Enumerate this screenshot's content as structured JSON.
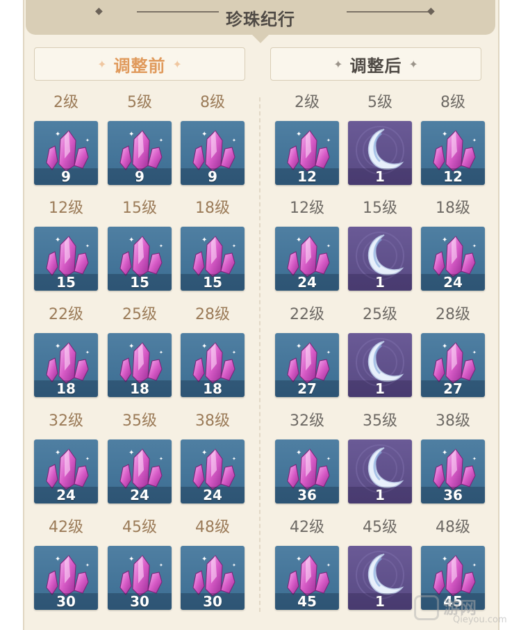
{
  "banner": {
    "title": "珍珠纪行"
  },
  "before": {
    "label": "调整前"
  },
  "after": {
    "label": "调整后"
  },
  "star_glyph": "✦",
  "levels": [
    [
      "2级",
      "5级",
      "8级"
    ],
    [
      "12级",
      "15级",
      "18级"
    ],
    [
      "22级",
      "25级",
      "28级"
    ],
    [
      "32级",
      "35级",
      "38级"
    ],
    [
      "42级",
      "45级",
      "48级"
    ]
  ],
  "before_rewards": [
    [
      {
        "item": "crystal",
        "count": "9"
      },
      {
        "item": "crystal",
        "count": "9"
      },
      {
        "item": "crystal",
        "count": "9"
      }
    ],
    [
      {
        "item": "crystal",
        "count": "15"
      },
      {
        "item": "crystal",
        "count": "15"
      },
      {
        "item": "crystal",
        "count": "15"
      }
    ],
    [
      {
        "item": "crystal",
        "count": "18"
      },
      {
        "item": "crystal",
        "count": "18"
      },
      {
        "item": "crystal",
        "count": "18"
      }
    ],
    [
      {
        "item": "crystal",
        "count": "24"
      },
      {
        "item": "crystal",
        "count": "24"
      },
      {
        "item": "crystal",
        "count": "24"
      }
    ],
    [
      {
        "item": "crystal",
        "count": "30"
      },
      {
        "item": "crystal",
        "count": "30"
      },
      {
        "item": "crystal",
        "count": "30"
      }
    ]
  ],
  "after_rewards": [
    [
      {
        "item": "crystal",
        "count": "12"
      },
      {
        "item": "moon",
        "count": "1"
      },
      {
        "item": "crystal",
        "count": "12"
      }
    ],
    [
      {
        "item": "crystal",
        "count": "24"
      },
      {
        "item": "moon",
        "count": "1"
      },
      {
        "item": "crystal",
        "count": "24"
      }
    ],
    [
      {
        "item": "crystal",
        "count": "27"
      },
      {
        "item": "moon",
        "count": "1"
      },
      {
        "item": "crystal",
        "count": "27"
      }
    ],
    [
      {
        "item": "crystal",
        "count": "36"
      },
      {
        "item": "moon",
        "count": "1"
      },
      {
        "item": "crystal",
        "count": "36"
      }
    ],
    [
      {
        "item": "crystal",
        "count": "45"
      },
      {
        "item": "moon",
        "count": "1"
      },
      {
        "item": "crystal",
        "count": "45"
      }
    ]
  ],
  "watermark": {
    "text": "游网",
    "sub": "Qieyou.com"
  },
  "colors": {
    "crystal_bg": "#4a7a9e",
    "moon_bg": "#64558f",
    "before_accent": "#e09a5c",
    "level_before": "#9b7b58",
    "level_after": "#6e6a65"
  }
}
